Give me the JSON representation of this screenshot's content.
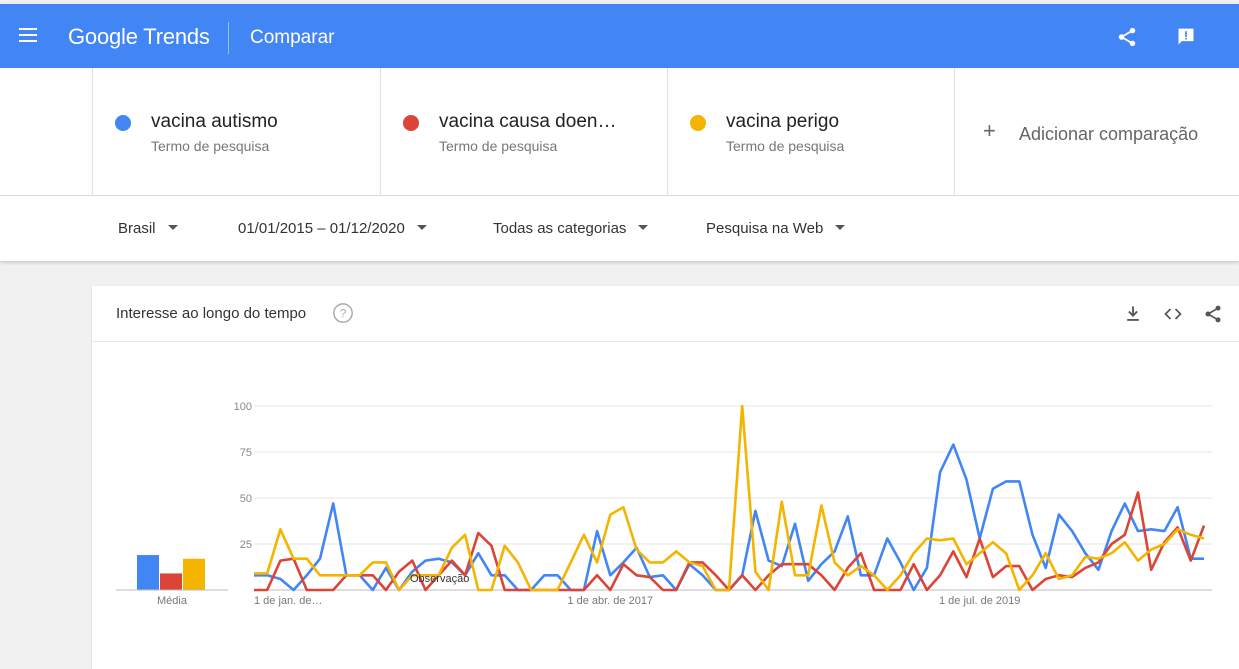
{
  "header": {
    "brand_google": "Google",
    "brand_trends": "Trends",
    "page_title": "Comparar"
  },
  "icons": {
    "menu": "menu-icon",
    "share": "share-icon",
    "feedback": "feedback-icon",
    "download": "download-icon",
    "embed": "embed-code-icon",
    "help": "help-icon",
    "add": "plus-icon"
  },
  "terms": [
    {
      "name": "vacina autismo",
      "type": "Termo de pesquisa",
      "color": "#4285f4"
    },
    {
      "name": "vacina causa doen…",
      "type": "Termo de pesquisa",
      "color": "#db4437"
    },
    {
      "name": "vacina perigo",
      "type": "Termo de pesquisa",
      "color": "#f4b400"
    }
  ],
  "add_comparison": "Adicionar comparação",
  "filters": {
    "region": "Brasil",
    "date_range": "01/01/2015 – 01/12/2020",
    "category": "Todas as categorias",
    "search_type": "Pesquisa na Web"
  },
  "card": {
    "title": "Interesse ao longo do tempo"
  },
  "chart_data": {
    "type": "line",
    "title": "",
    "average_label": "Média",
    "annotation": "Observação",
    "ylim": [
      0,
      100
    ],
    "yticks": [
      100,
      75,
      50,
      25
    ],
    "xtick_labels": [
      "1 de jan. de…",
      "1 de abr. de 2017",
      "1 de jul. de 2019"
    ],
    "x_index_of_ticks": [
      0,
      27,
      55
    ],
    "averages": [
      {
        "name": "vacina autismo",
        "value": 19
      },
      {
        "name": "vacina causa doen…",
        "value": 9
      },
      {
        "name": "vacina perigo",
        "value": 17
      }
    ],
    "series": [
      {
        "name": "vacina autismo",
        "color": "#4285f4",
        "values": [
          8,
          8,
          6,
          0,
          8,
          17,
          47,
          8,
          8,
          0,
          12,
          0,
          10,
          16,
          17,
          15,
          8,
          20,
          8,
          8,
          0,
          0,
          8,
          8,
          0,
          0,
          32,
          8,
          15,
          23,
          7,
          8,
          0,
          14,
          8,
          0,
          0,
          8,
          43,
          16,
          13,
          36,
          5,
          14,
          21,
          40,
          8,
          8,
          28,
          15,
          0,
          12,
          64,
          79,
          60,
          28,
          55,
          59,
          59,
          30,
          12,
          41,
          32,
          20,
          11,
          32,
          47,
          32,
          33,
          32,
          45,
          17,
          17
        ]
      },
      {
        "name": "vacina causa doen…",
        "color": "#db4437",
        "values": [
          0,
          0,
          16,
          17,
          0,
          0,
          0,
          8,
          8,
          8,
          0,
          10,
          16,
          0,
          8,
          16,
          8,
          31,
          24,
          0,
          0,
          0,
          0,
          0,
          0,
          0,
          8,
          0,
          14,
          8,
          7,
          0,
          0,
          15,
          15,
          8,
          0,
          8,
          0,
          8,
          14,
          14,
          14,
          8,
          0,
          12,
          20,
          0,
          0,
          0,
          14,
          0,
          8,
          21,
          7,
          28,
          7,
          13,
          13,
          0,
          6,
          8,
          7,
          12,
          15,
          25,
          30,
          53,
          11,
          26,
          34,
          16,
          35
        ]
      },
      {
        "name": "vacina perigo",
        "color": "#f4b400",
        "values": [
          9,
          9,
          33,
          17,
          17,
          8,
          8,
          8,
          8,
          15,
          15,
          0,
          8,
          8,
          8,
          23,
          30,
          0,
          0,
          24,
          15,
          0,
          0,
          0,
          15,
          30,
          15,
          41,
          45,
          22,
          15,
          15,
          21,
          15,
          13,
          0,
          0,
          100,
          10,
          0,
          48,
          8,
          8,
          46,
          15,
          8,
          13,
          8,
          0,
          8,
          20,
          28,
          27,
          28,
          14,
          20,
          26,
          20,
          0,
          8,
          20,
          6,
          8,
          18,
          17,
          20,
          26,
          16,
          22,
          25,
          33,
          30,
          28
        ]
      }
    ]
  }
}
